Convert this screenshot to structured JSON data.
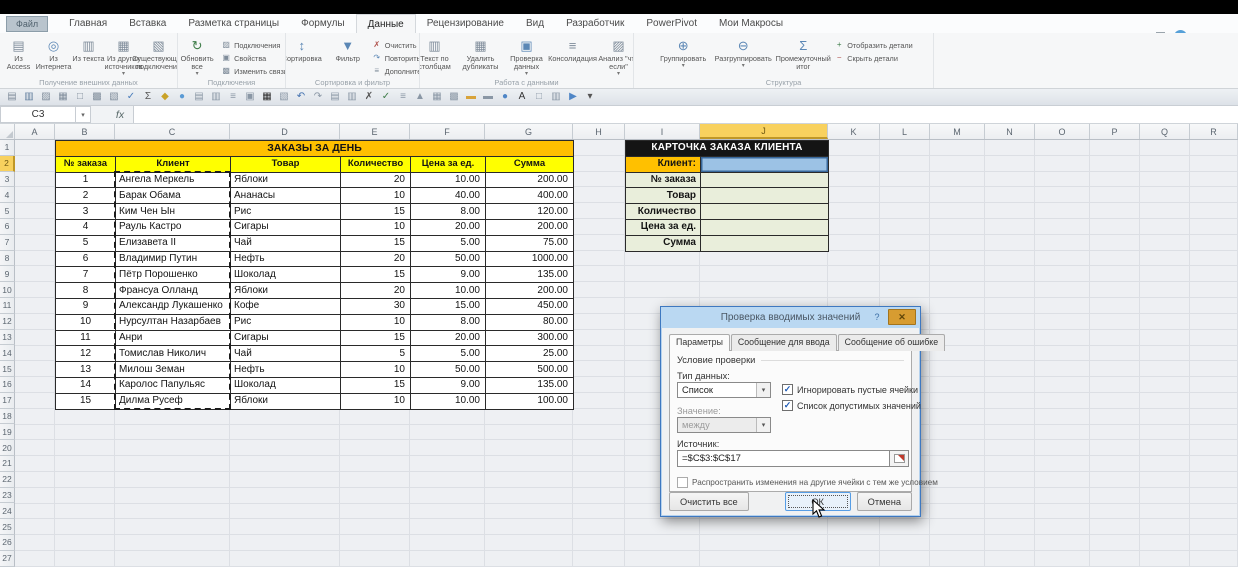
{
  "ribbon": {
    "file_tab": "Файл",
    "tabs": [
      "Главная",
      "Вставка",
      "Разметка страницы",
      "Формулы",
      "Данные",
      "Рецензирование",
      "Вид",
      "Разработчик",
      "PowerPivot",
      "Мои Макросы"
    ],
    "active_tab": "Данные",
    "groups": [
      {
        "label": "Получение внешних данных",
        "items": [
          {
            "label": "Из Access",
            "icon": "access"
          },
          {
            "label": "Из Интернета",
            "icon": "web"
          },
          {
            "label": "Из текста",
            "icon": "text-file"
          },
          {
            "label": "Из других источников",
            "icon": "other-sources",
            "dropdown": true
          },
          {
            "label": "Существующие подключения",
            "icon": "existing-connections"
          }
        ]
      },
      {
        "label": "Подключения",
        "items": [
          {
            "label": "Обновить все",
            "icon": "refresh",
            "dropdown": true
          },
          {
            "stack": [
              {
                "label": "Подключения",
                "icon": "connections"
              },
              {
                "label": "Свойства",
                "icon": "properties"
              },
              {
                "label": "Изменить связи",
                "icon": "edit-links"
              }
            ]
          }
        ]
      },
      {
        "label": "Сортировка и фильтр",
        "items": [
          {
            "stack": [
              {
                "label": "",
                "icon": "sort-az"
              },
              {
                "label": "",
                "icon": "sort-za"
              }
            ]
          },
          {
            "label": "Сортировка",
            "icon": "sort"
          },
          {
            "label": "Фильтр",
            "icon": "filter"
          },
          {
            "stack": [
              {
                "label": "Очистить",
                "icon": "clear"
              },
              {
                "label": "Повторить",
                "icon": "reapply"
              },
              {
                "label": "Дополнительно",
                "icon": "advanced"
              }
            ]
          }
        ]
      },
      {
        "label": "Работа с данными",
        "items": [
          {
            "label": "Текст по столбцам",
            "icon": "text-to-columns"
          },
          {
            "label": "Удалить дубликаты",
            "icon": "remove-duplicates"
          },
          {
            "label": "Проверка данных",
            "icon": "data-validation",
            "dropdown": true
          },
          {
            "label": "Консолидация",
            "icon": "consolidate"
          },
          {
            "label": "Анализ \"что если\"",
            "icon": "what-if",
            "dropdown": true
          }
        ]
      },
      {
        "label": "Структура",
        "items": [
          {
            "label": "Группировать",
            "icon": "group",
            "dropdown": true
          },
          {
            "label": "Разгруппировать",
            "icon": "ungroup",
            "dropdown": true
          },
          {
            "label": "Промежуточный итог",
            "icon": "subtotal"
          },
          {
            "stack": [
              {
                "label": "Отобразить детали",
                "icon": "show-detail"
              },
              {
                "label": "Скрыть детали",
                "icon": "hide-detail"
              }
            ]
          }
        ]
      }
    ]
  },
  "window_controls": [
    "ribbon-options",
    "help",
    "minimize",
    "restore",
    "close"
  ],
  "qat": {
    "icons": [
      "file",
      "save",
      "mail",
      "print",
      "preview",
      "copy",
      "paste",
      "spell",
      "sum",
      "fill",
      "flower",
      "doc",
      "sheet",
      "link",
      "bracket",
      "grid-dark",
      "page",
      "undo",
      "redo",
      "cells",
      "columns",
      "delete",
      "check",
      "more",
      "chart",
      "borders",
      "calc",
      "pen-yellow",
      "pen-gray",
      "globe",
      "font",
      "comment",
      "sheet2",
      "triangle",
      "dropdown"
    ]
  },
  "formula_bar": {
    "name_box": "C3",
    "fx_label": "fx"
  },
  "grid": {
    "columns": [
      "A",
      "B",
      "C",
      "D",
      "E",
      "F",
      "G",
      "H",
      "I",
      "J",
      "K",
      "L",
      "M",
      "N",
      "O",
      "P",
      "Q",
      "R"
    ],
    "row_count": 27,
    "selected_column": "J",
    "selected_row": 2,
    "active_cell": "J2"
  },
  "orders_table": {
    "title": "ЗАКАЗЫ ЗА ДЕНЬ",
    "headers": [
      "№ заказа",
      "Клиент",
      "Товар",
      "Количество",
      "Цена за ед.",
      "Сумма"
    ],
    "rows": [
      [
        "1",
        "Ангела Меркель",
        "Яблоки",
        "20",
        "10.00",
        "200.00"
      ],
      [
        "2",
        "Барак Обама",
        "Ананасы",
        "10",
        "40.00",
        "400.00"
      ],
      [
        "3",
        "Ким Чен Ын",
        "Рис",
        "15",
        "8.00",
        "120.00"
      ],
      [
        "4",
        "Рауль Кастро",
        "Сигары",
        "10",
        "20.00",
        "200.00"
      ],
      [
        "5",
        "Елизавета II",
        "Чай",
        "15",
        "5.00",
        "75.00"
      ],
      [
        "6",
        "Владимир Путин",
        "Нефть",
        "20",
        "50.00",
        "1000.00"
      ],
      [
        "7",
        "Пётр Порошенко",
        "Шоколад",
        "15",
        "9.00",
        "135.00"
      ],
      [
        "8",
        "Франсуа Олланд",
        "Яблоки",
        "20",
        "10.00",
        "200.00"
      ],
      [
        "9",
        "Александр Лукашенко",
        "Кофе",
        "30",
        "15.00",
        "450.00"
      ],
      [
        "10",
        "Нурсултан Назарбаев",
        "Рис",
        "10",
        "8.00",
        "80.00"
      ],
      [
        "11",
        "Анри",
        "Сигары",
        "15",
        "20.00",
        "300.00"
      ],
      [
        "12",
        "Томислав Николич",
        "Чай",
        "5",
        "5.00",
        "25.00"
      ],
      [
        "13",
        "Милош Земан",
        "Нефть",
        "10",
        "50.00",
        "500.00"
      ],
      [
        "14",
        "Каролос Папульяс",
        "Шоколад",
        "15",
        "9.00",
        "135.00"
      ],
      [
        "15",
        "Дилма Русеф",
        "Яблоки",
        "10",
        "10.00",
        "100.00"
      ]
    ],
    "source_range": "C3:C17"
  },
  "order_card": {
    "title": "КАРТОЧКА ЗАКАЗА КЛИЕНТА",
    "fields": [
      "Клиент:",
      "№ заказа",
      "Товар",
      "Количество",
      "Цена за ед.",
      "Сумма"
    ]
  },
  "dialog": {
    "title": "Проверка вводимых значений",
    "tabs": [
      "Параметры",
      "Сообщение для ввода",
      "Сообщение об ошибке"
    ],
    "active_tab": "Параметры",
    "group_label": "Условие проверки",
    "type_label": "Тип данных:",
    "type_value": "Список",
    "check1": "Игнорировать пустые ячейки",
    "check2": "Список допустимых значений",
    "value_label": "Значение:",
    "value_value": "между",
    "source_label": "Источник:",
    "source_value": "=$C$3:$C$17",
    "propagate_label": "Распространить изменения на другие ячейки с тем же условием",
    "buttons": {
      "clear": "Очистить все",
      "ok": "ОК",
      "cancel": "Отмена"
    }
  },
  "colors": {
    "accent_orange": "#ffc000",
    "accent_yellow": "#ffff00",
    "selection_blue": "#9cc2e5",
    "header_select": "#f8d15e",
    "card_green": "#e9eedb",
    "dialog_titlebar": "#bad8f2",
    "close_button": "#d79c31"
  }
}
